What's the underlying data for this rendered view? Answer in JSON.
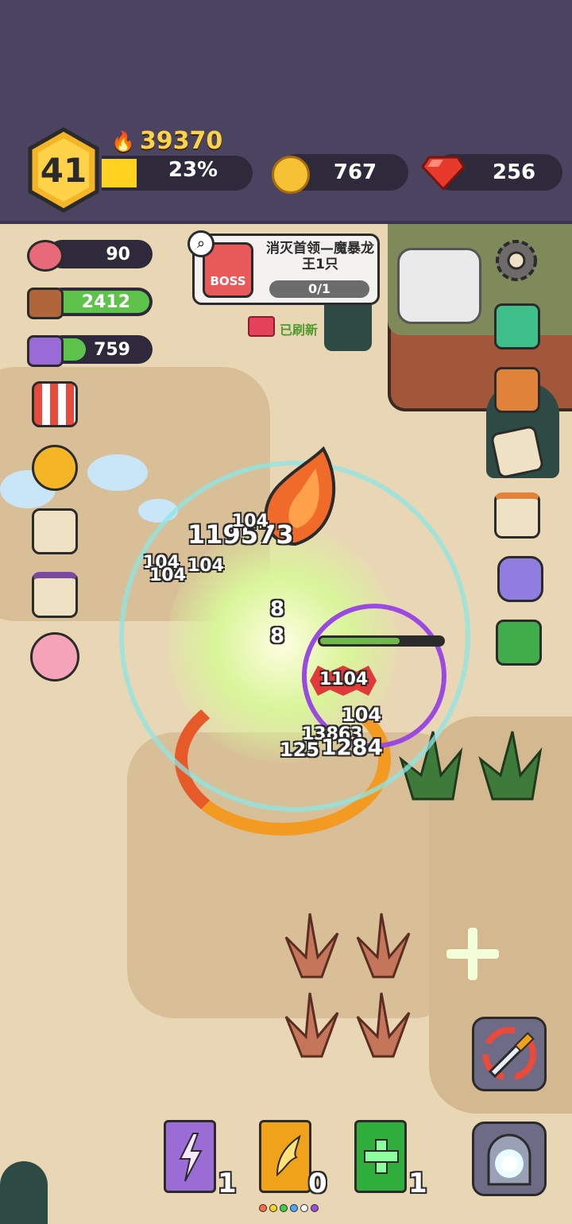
{
  "player": {
    "level": "41",
    "power": "39370",
    "xp_percent_label": "23%",
    "xp_fraction": 0.23
  },
  "currencies": {
    "gold": "767",
    "gems": "256"
  },
  "resources": {
    "meat": "90",
    "wood": "2412",
    "ore": "759"
  },
  "quest": {
    "title": "消灭首领—魔暴龙王1只",
    "progress": "0/1",
    "boss_badge": "BOSS",
    "refreshed": "已刷新"
  },
  "damage_numbers": {
    "big": "119573",
    "d1": "104",
    "d2": "104",
    "d3": "104",
    "d4": "104",
    "d5": "8",
    "d6": "8",
    "d7": "1104",
    "d8": "104",
    "d9": "1284",
    "d10": "125",
    "d11": "13863"
  },
  "skill_books": [
    {
      "name": "lightning-book",
      "count": "1",
      "color": "#9b6bd6"
    },
    {
      "name": "wing-book",
      "count": "0",
      "color": "#f0a21a"
    },
    {
      "name": "heal-book",
      "count": "1",
      "color": "#2fae3c"
    }
  ],
  "gem_dots": [
    "#ff6a3c",
    "#ffd21f",
    "#3ccf4a",
    "#4aa8ff",
    "#ffffff",
    "#a04ae0"
  ],
  "colors": {
    "topbar": "#4a4461",
    "accent_yellow": "#ffd21f",
    "resource_green": "#5ec34a"
  }
}
